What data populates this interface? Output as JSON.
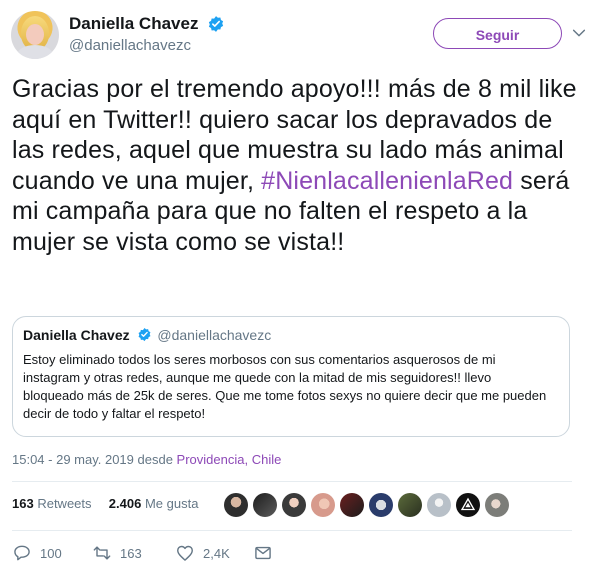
{
  "header": {
    "display_name": "Daniella Chavez",
    "handle": "@daniellachavezc",
    "follow_label": "Seguir",
    "accent_color": "#8d49b7"
  },
  "tweet": {
    "text_part1": "Gracias por el tremendo apoyo!!! más de 8 mil like aquí en Twitter!!  quiero sacar los depravados de las redes, aquel que muestra su lado más animal cuando ve una mujer, ",
    "hashtag": "#NienlacallenienlaRed",
    "text_part2": " será mi campaña para que no falten el respeto a la mujer se vista como se vista!!"
  },
  "quoted_tweet": {
    "display_name": "Daniella Chavez",
    "handle": "@daniellachavezc",
    "text": "Estoy eliminado todos los seres morbosos con sus comentarios asquerosos de mi instagram y otras redes, aunque me quede con la mitad de mis seguidores!! llevo bloqueado más de 25k de seres. Que me tome fotos sexys no quiere decir que me pueden decir de todo y faltar el respeto!"
  },
  "meta": {
    "time": "15:04 - 29 may. 2019 desde ",
    "place": "Providencia, Chile"
  },
  "stats": {
    "retweets_count": "163",
    "retweets_label": "Retweets",
    "likes_count": "2.406",
    "likes_label": "Me gusta"
  },
  "actions": {
    "replies": "100",
    "retweets": "163",
    "likes": "2,4K"
  },
  "icons": {
    "verified": "verified-badge-icon",
    "caret": "chevron-down-icon",
    "reply": "reply-icon",
    "retweet": "retweet-icon",
    "like": "heart-icon",
    "dm": "envelope-icon"
  }
}
